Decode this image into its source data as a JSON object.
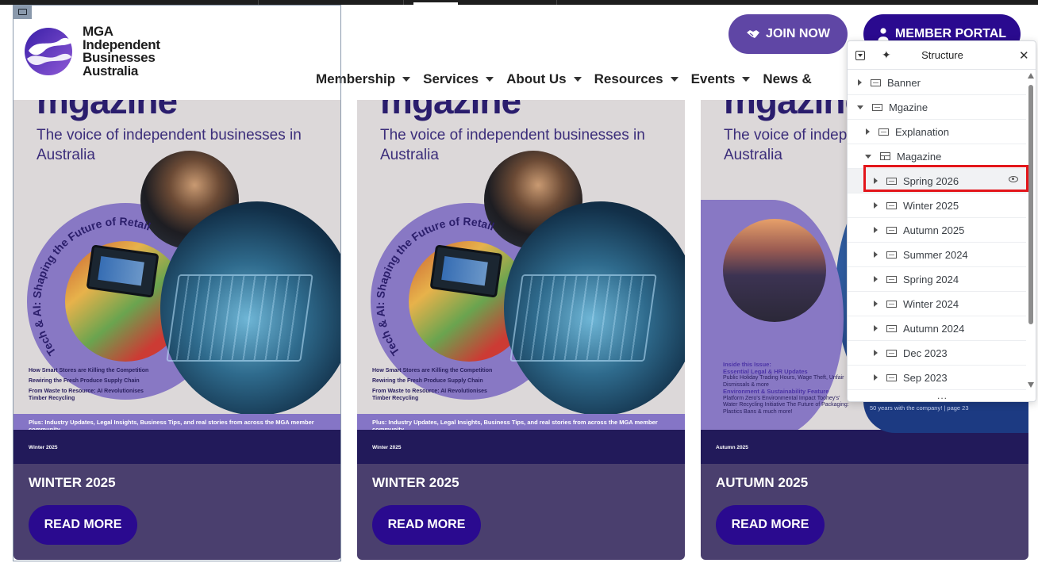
{
  "header": {
    "logo_lines": [
      "MGA",
      "Independent",
      "Businesses",
      "Australia"
    ],
    "join_label": "JOIN NOW",
    "portal_label": "MEMBER PORTAL",
    "nav": [
      "Membership",
      "Services",
      "About Us",
      "Resources",
      "Events",
      "News &"
    ]
  },
  "cards": [
    {
      "cover_title": "mgazine",
      "cover_subtitle": "The voice of independent businesses in Australia",
      "ring_text": "Tech & AI: Shaping the Future of Retail",
      "bullets": [
        "How Smart Stores are Killing the Competition",
        "Rewiring the Fresh Produce Supply Chain",
        "From Waste to Resource: AI Revolutionises Timber Recycling"
      ],
      "plus": "Plus: Industry Updates, Legal Insights, Business Tips, and real stories from across the MGA member community",
      "issue": "Winter 2025",
      "title": "WINTER 2025",
      "button": "READ MORE"
    },
    {
      "cover_title": "mgazine",
      "cover_subtitle": "The voice of independent businesses in Australia",
      "ring_text": "Tech & AI: Shaping the Future of Retail",
      "bullets": [
        "How Smart Stores are Killing the Competition",
        "Rewiring the Fresh Produce Supply Chain",
        "From Waste to Resource: AI Revolutionises Timber Recycling"
      ],
      "plus": "Plus: Industry Updates, Legal Insights, Business Tips, and real stories from across the MGA member community",
      "issue": "Winter 2025",
      "title": "WINTER 2025",
      "button": "READ MORE"
    },
    {
      "cover_title": "mgazine",
      "cover_subtitle": "The voice of independent businesses in Australia",
      "inside_heading": "Inside this Issue:",
      "sections": [
        {
          "heading": "Essential Legal & HR Updates",
          "text": "Public Holiday Trading Hours, Wage Theft, Unfair Dismissals & more"
        },
        {
          "heading": "Environment & Sustainability Feature",
          "text": "Platform Zero's Environmental Impact Toohey's' Water Recycling Initiative The Future of Packaging: Plastics Bans & much more!"
        }
      ],
      "issue": "Autumn 2025",
      "side_note": "50 years with the company! | page 23",
      "title": "AUTUMN 2025",
      "button": "READ MORE"
    }
  ],
  "structure_panel": {
    "title": "Structure",
    "rows": [
      {
        "label": "Banner",
        "state": "collapsed",
        "icon": "section-icon"
      },
      {
        "label": "Mgazine",
        "state": "expanded",
        "icon": "section-icon"
      },
      {
        "label": "Explanation",
        "state": "collapsed",
        "icon": "section-icon"
      },
      {
        "label": "Magazine",
        "state": "expanded",
        "icon": "grid-icon"
      },
      {
        "label": "Spring 2026",
        "state": "collapsed",
        "icon": "section-icon",
        "selected": true
      },
      {
        "label": "Winter 2025",
        "state": "collapsed",
        "icon": "section-icon"
      },
      {
        "label": "Autumn 2025",
        "state": "collapsed",
        "icon": "section-icon"
      },
      {
        "label": "Summer 2024",
        "state": "collapsed",
        "icon": "section-icon"
      },
      {
        "label": "Spring 2024",
        "state": "collapsed",
        "icon": "section-icon"
      },
      {
        "label": "Winter 2024",
        "state": "collapsed",
        "icon": "section-icon"
      },
      {
        "label": "Autumn 2024",
        "state": "collapsed",
        "icon": "section-icon"
      },
      {
        "label": "Dec 2023",
        "state": "collapsed",
        "icon": "section-icon"
      },
      {
        "label": "Sep 2023",
        "state": "collapsed",
        "icon": "section-icon"
      }
    ],
    "more": "..."
  },
  "colors": {
    "primary": "#2a0a8f",
    "accent": "#5f46a5",
    "card_bg": "#4a3f6e",
    "highlight": "#e3151a"
  }
}
